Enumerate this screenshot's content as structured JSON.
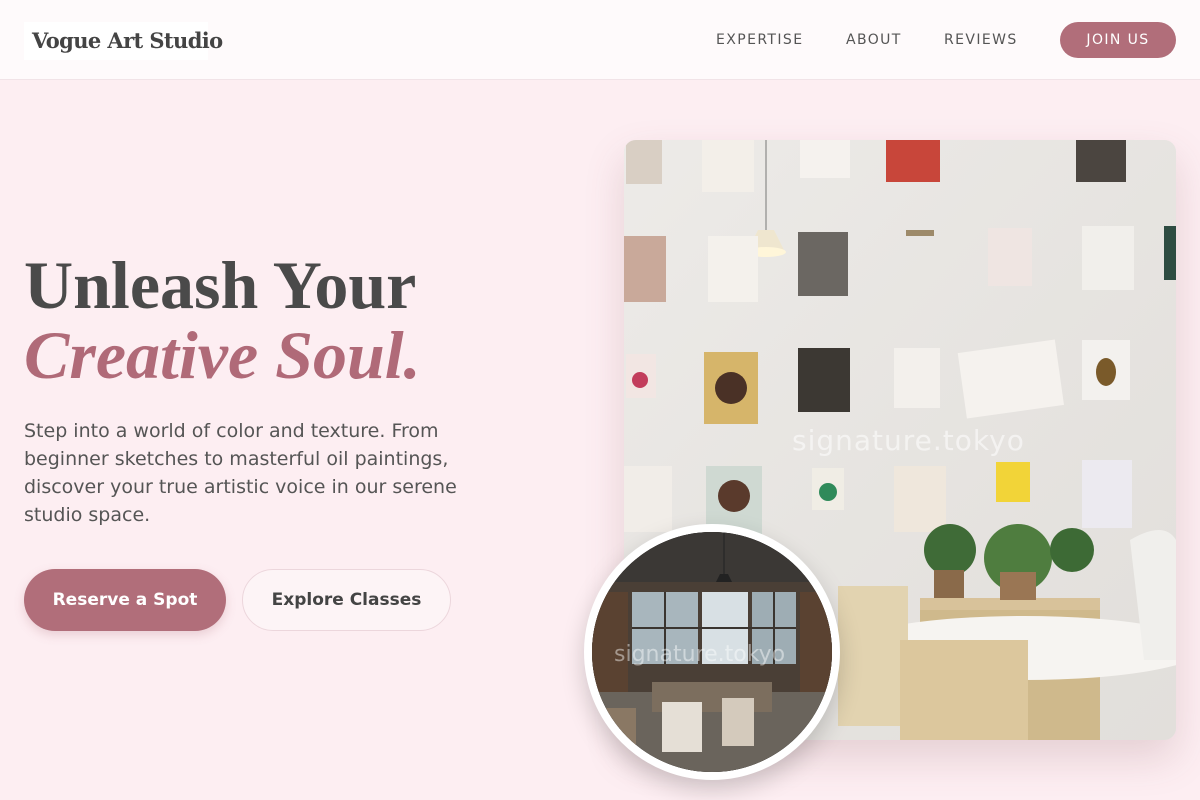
{
  "header": {
    "logo": "Vogue Art Studio",
    "nav": [
      "EXPERTISE",
      "ABOUT",
      "REVIEWS"
    ],
    "cta": "JOIN US"
  },
  "hero": {
    "title_line1": "Unleash Your",
    "title_line2": "Creative Soul.",
    "description": "Step into a world of color and texture. From beginner sketches to masterful oil paintings, discover your true artistic voice in our serene studio space.",
    "primary_button": "Reserve a Spot",
    "secondary_button": "Explore Classes"
  },
  "images": {
    "main_watermark": "signature.tokyo",
    "circle_watermark": "signature.tokyo"
  },
  "colors": {
    "background": "#fdeef2",
    "accent": "#b16e7a",
    "text": "#4a4a4a"
  }
}
